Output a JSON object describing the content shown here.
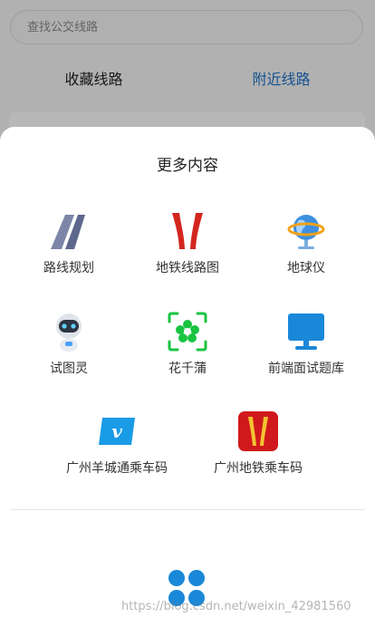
{
  "search": {
    "placeholder": "查找公交线路"
  },
  "tabs": [
    {
      "label": "收藏线路",
      "active": false
    },
    {
      "label": "附近线路",
      "active": true
    }
  ],
  "sheet": {
    "title": "更多内容",
    "items": [
      {
        "label": "路线规划",
        "icon": "route-plan-icon"
      },
      {
        "label": "地铁线路图",
        "icon": "metro-line-icon"
      },
      {
        "label": "地球仪",
        "icon": "globe-icon"
      },
      {
        "label": "试图灵",
        "icon": "robot-icon"
      },
      {
        "label": "花千蒲",
        "icon": "flower-scan-icon"
      },
      {
        "label": "前端面试题库",
        "icon": "monitor-icon"
      },
      {
        "label": "广州羊城通乘车码",
        "icon": "vimeo-card-icon"
      },
      {
        "label": "广州地铁乘车码",
        "icon": "guangzhou-metro-icon"
      }
    ]
  },
  "watermark": "https://blog.csdn.net/weixin_42981560",
  "colors": {
    "accent": "#1d72c7",
    "metro_red": "#d3261f",
    "apps_blue": "#1a88d8"
  }
}
